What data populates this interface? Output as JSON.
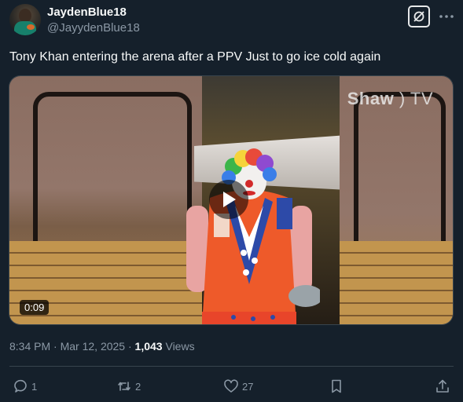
{
  "author": {
    "display_name": "JaydenBlue18",
    "handle": "@JayydenBlue18"
  },
  "tweet": {
    "text": "Tony Khan entering the arena after a PPV Just to go ice cold again"
  },
  "video": {
    "watermark_brand": "Shaw",
    "watermark_suffix": "TV",
    "duration": "0:09"
  },
  "meta": {
    "time": "8:34 PM",
    "separator1": " · ",
    "date": "Mar 12, 2025",
    "separator2": " · ",
    "views_count": "1,043",
    "views_label": " Views"
  },
  "actions": {
    "replies": "1",
    "reposts": "2",
    "likes": "27"
  },
  "icons": {
    "grok": "grok-icon",
    "more": "more-horizontal-icon",
    "reply": "reply-icon",
    "repost": "repost-icon",
    "like": "heart-icon",
    "bookmark": "bookmark-icon",
    "share": "share-icon",
    "play": "play-icon"
  },
  "colors": {
    "background": "#15202b",
    "primary_text": "#f7f9f9",
    "secondary_text": "#8b98a5",
    "border": "#38444d"
  }
}
